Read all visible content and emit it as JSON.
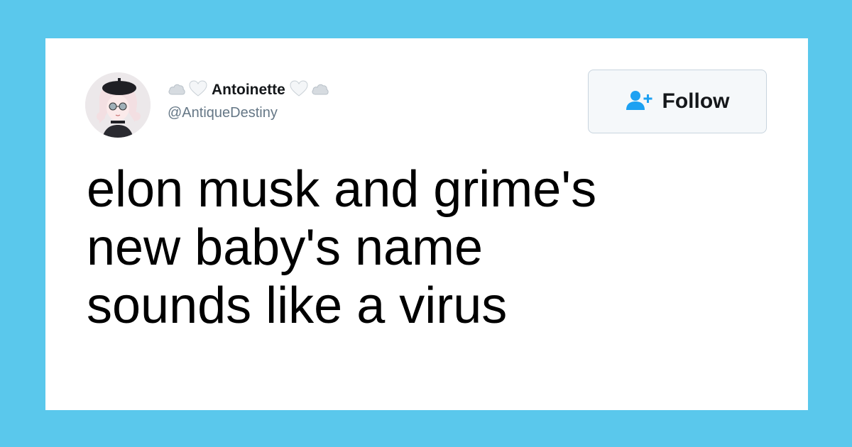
{
  "colors": {
    "background": "#5ac8ec",
    "card": "#ffffff",
    "handle": "#657786",
    "follow_icon": "#1da1f2",
    "text": "#000000"
  },
  "user": {
    "avatar_icon": "anime-avatar-icon",
    "name_prefix_icons": [
      "cloud-icon",
      "white-heart-icon"
    ],
    "display_name": "Antoinette",
    "name_suffix_icons": [
      "white-heart-icon",
      "cloud-icon"
    ],
    "handle": "@AntiqueDestiny"
  },
  "follow_button": {
    "icon": "follow-person-plus-icon",
    "label": "Follow"
  },
  "tweet": {
    "text": "elon musk and grime's\nnew baby's name\nsounds like a virus"
  }
}
